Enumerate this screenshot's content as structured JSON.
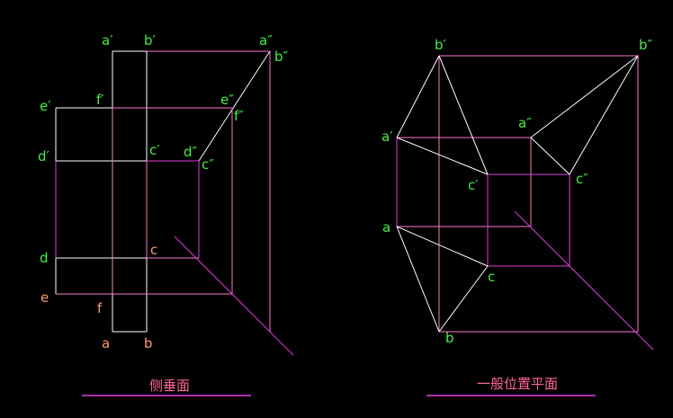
{
  "colors": {
    "background": "#000000",
    "white_line": "#ffffff",
    "pink_line": "#ff77cc",
    "magenta_line": "#e23ce2",
    "green_text": "#44ee44",
    "orange_text": "#ff9966",
    "caption_text": "#ff6699",
    "underline": "#e23ce2"
  },
  "left": {
    "caption": "侧垂面",
    "labels": {
      "a_prime": "a′",
      "b_prime": "b′",
      "a_dprime": "a″",
      "b_dprime": "b″",
      "e_prime": "e′",
      "f_prime": "f′",
      "e_dprime": "e″",
      "f_dprime": "f″",
      "d_prime": "d′",
      "c_prime": "c′",
      "d_dprime": "d″",
      "c_dprime": "c″",
      "d": "d",
      "c": "c",
      "e": "e",
      "f": "f",
      "a": "a",
      "b": "b"
    }
  },
  "right": {
    "caption": "一般位置平面",
    "labels": {
      "b_prime": "b′",
      "b_dprime": "b″",
      "a_prime": "a′",
      "a_dprime": "a″",
      "c_prime": "c′",
      "c_dprime": "c″",
      "a": "a",
      "c": "c",
      "b": "b"
    }
  }
}
